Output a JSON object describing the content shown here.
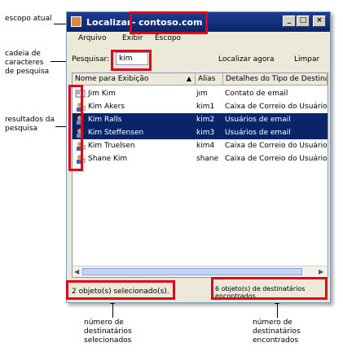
{
  "window": {
    "title": "Localizar",
    "scope": "contoso.com",
    "min_glyph": "_",
    "max_glyph": "□",
    "close_glyph": "×"
  },
  "menu": {
    "items": [
      "Arquivo",
      "Exibir",
      "Escopo"
    ]
  },
  "search": {
    "label": "Pesquisar:",
    "value": "kim",
    "find_now_label": "Localizar agora",
    "clear_label": "Limpar"
  },
  "columns": [
    "Nome para Exibição",
    "Alias",
    "Detalhes do Tipo de Destinatário"
  ],
  "rows": [
    {
      "name": "Jim Kim",
      "alias": "jım",
      "type": "Contato de email",
      "icon": "contact-icon",
      "selected": false
    },
    {
      "name": "Kim Akers",
      "alias": "kim1",
      "type": "Caixa de Correio do Usuário",
      "icon": "user-icon",
      "selected": false
    },
    {
      "name": "Kim Ralls",
      "alias": "kim2",
      "type": "Usuários de email",
      "icon": "user-icon",
      "selected": true
    },
    {
      "name": "Kim Steffensen",
      "alias": "kim3",
      "type": "Usuários de email",
      "icon": "user-icon",
      "selected": true
    },
    {
      "name": "Kim Truelsen",
      "alias": "kim4",
      "type": "Caixa de Correio do Usuário",
      "icon": "user-icon",
      "selected": false
    },
    {
      "name": "Shane Kim",
      "alias": "shane",
      "type": "Caixa de Correio do Usuário",
      "icon": "user-icon",
      "selected": false
    }
  ],
  "status": {
    "selected_text": "2 objeto(s) selecionado(s).",
    "found_text": "6 objeto(s) de destinatários encontrados"
  },
  "callouts": {
    "scope": "escopo atual",
    "search_string": "cadeia de caracteres de pesquisa",
    "results": "resultados da pesquisa",
    "selected_count": "número de destinatários selecionados",
    "found_count": "número de destinatários encontrados"
  },
  "colors": {
    "highlight": "#e0001a",
    "selection": "#0a246a",
    "titlebar": "#0a246a"
  }
}
